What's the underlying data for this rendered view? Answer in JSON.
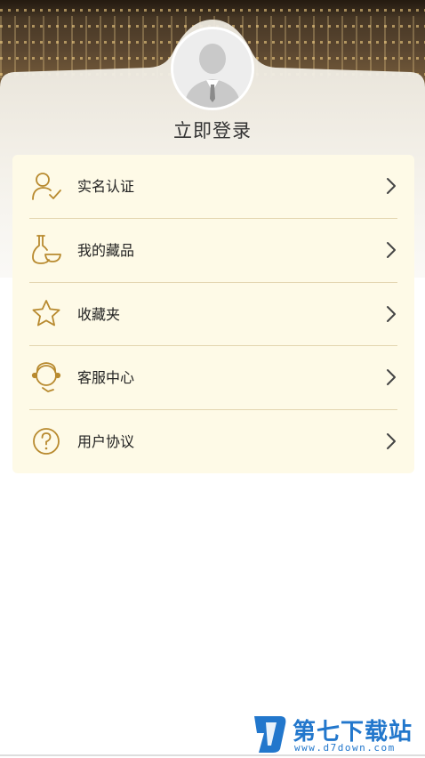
{
  "header": {
    "login_label": "立即登录",
    "avatar_icon": "default-user-avatar"
  },
  "menu": {
    "items": [
      {
        "label": "实名认证",
        "icon": "user-check-icon"
      },
      {
        "label": "我的藏品",
        "icon": "vase-icon"
      },
      {
        "label": "收藏夹",
        "icon": "star-icon"
      },
      {
        "label": "客服中心",
        "icon": "headset-icon"
      },
      {
        "label": "用户协议",
        "icon": "question-circle-icon"
      }
    ],
    "chevron_icon": "chevron-right-icon"
  },
  "watermark": {
    "title": "第七下载站",
    "url": "www.d7down.com"
  },
  "colors": {
    "accent": "#b88a2f",
    "panel": "#fefae7",
    "divider": "#e3d5b0",
    "watermark": "#2277cc"
  }
}
